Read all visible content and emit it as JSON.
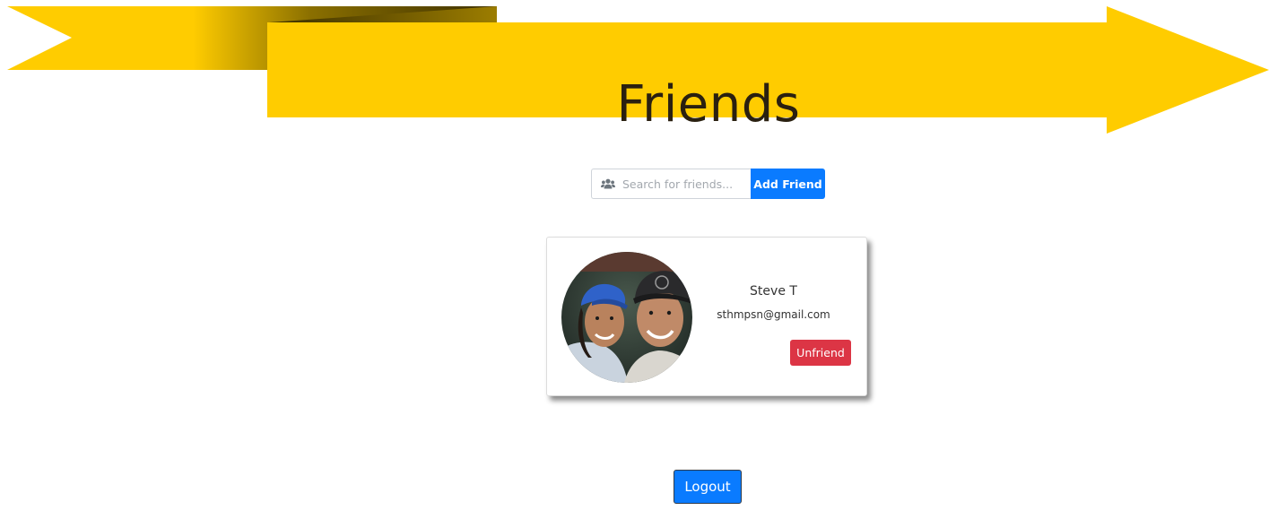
{
  "header": {
    "title": "Friends"
  },
  "search": {
    "placeholder": "Search for friends...",
    "value": "",
    "icon": "users-icon",
    "add_button_label": "Add Friend"
  },
  "friends": [
    {
      "name": "Steve T",
      "email": "sthmpsn@gmail.com",
      "unfriend_label": "Unfriend"
    }
  ],
  "footer": {
    "logout_label": "Logout"
  },
  "colors": {
    "banner": "#ffcc00",
    "primary_button": "#0a7bff",
    "danger_button": "#dc3545"
  }
}
